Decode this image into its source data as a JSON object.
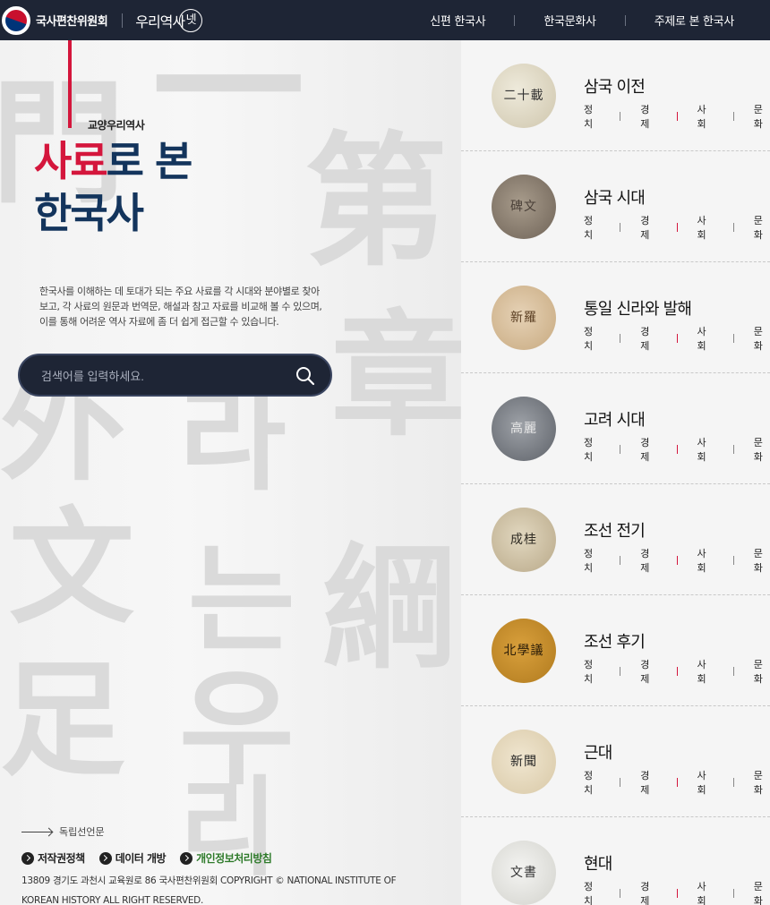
{
  "header": {
    "logo_text": "국사편찬위원회",
    "brand_text": "우리역사",
    "brand_circle": "넷",
    "nav": [
      "신편 한국사",
      "한국문화사",
      "주제로 본 한국사"
    ]
  },
  "hero": {
    "subtitle": "교양우리역사",
    "title_red": "사료",
    "title_rest1": "로 본",
    "title_line2": "한국사",
    "description": "한국사를 이해하는 데 토대가 되는 주요 사료를 각 시대와 분야별로 찾아보고, 각 사료의 원문과 번역문, 해설과 참고 자료를 비교해 볼 수 있으며, 이를 통해 어려운 역사 자료에 좀 더 쉽게 접근할 수 있습니다.",
    "search_placeholder": "검색어를 입력하세요."
  },
  "footer": {
    "declaration": "독립선언문",
    "links": [
      "저작권정책",
      "데이터 개방",
      "개인정보처리방침"
    ],
    "copyright": "13809 경기도 과천시 교육원로 86 국사편찬위원회  COPYRIGHT © NATIONAL INSTITUTE OF KOREAN HISTORY ALL RIGHT RESERVED."
  },
  "periods": [
    {
      "title": "삼국 이전",
      "thumb_text": "二十載"
    },
    {
      "title": "삼국 시대",
      "thumb_text": "碑文"
    },
    {
      "title": "통일 신라와 발해",
      "thumb_text": "新羅"
    },
    {
      "title": "고려 시대",
      "thumb_text": "高麗"
    },
    {
      "title": "조선 전기",
      "thumb_text": "成桂"
    },
    {
      "title": "조선 후기",
      "thumb_text": "北學議"
    },
    {
      "title": "근대",
      "thumb_text": "新聞"
    },
    {
      "title": "현대",
      "thumb_text": "文書"
    }
  ],
  "categories": [
    "정치",
    "경제",
    "사회",
    "문화"
  ],
  "colors": {
    "navy": "#1e2535",
    "accent_red": "#d4163c",
    "title_blue": "#13345c",
    "link_green": "#2f7b2b"
  }
}
